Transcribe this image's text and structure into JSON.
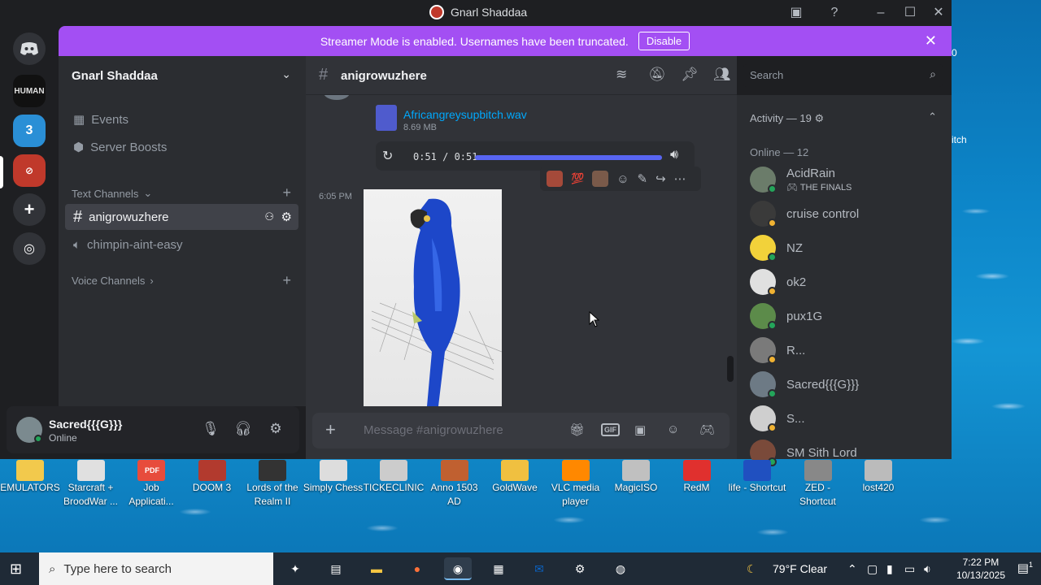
{
  "window": {
    "title": "Gnarl Shaddaa"
  },
  "banner": {
    "text": "Streamer Mode is enabled. Usernames have been truncated.",
    "disable": "Disable"
  },
  "server": {
    "name": "Gnarl Shaddaa"
  },
  "channels": {
    "events": "Events",
    "boosts": "Server Boosts",
    "text_category": "Text Channels",
    "text": [
      "anigrowuzhere",
      "chimpin-aint-easy"
    ],
    "voice_category": "Voice Channels"
  },
  "rail": {
    "server1": "HUMAN",
    "server2": "3"
  },
  "user": {
    "name": "Sacred{{{G}}}",
    "status": "Online"
  },
  "chat": {
    "channel": "anigrowuzhere",
    "file_name": "Africangreysupbitch.wav",
    "file_size": "8.69 MB",
    "audio_time": "0:51 / 0:51",
    "audio_progress": 1.0,
    "react_emoji": "💯",
    "msg_time": "6:05 PM",
    "placeholder": "Message #anigrowuzhere",
    "gif": "GIF"
  },
  "search": {
    "placeholder": "Search"
  },
  "members": {
    "activity": "Activity — 19",
    "online": "Online — 12",
    "list": [
      {
        "name": "AcidRain",
        "activity": "THE FINALS",
        "status": "#23a55a"
      },
      {
        "name": "cruise control",
        "activity": "",
        "status": "#f0b232"
      },
      {
        "name": "NZ",
        "activity": "",
        "status": "#23a55a"
      },
      {
        "name": "ok2",
        "activity": "",
        "status": "#f0b232"
      },
      {
        "name": "pux1G",
        "activity": "",
        "status": "#23a55a"
      },
      {
        "name": "R...",
        "activity": "",
        "status": "#f0b232"
      },
      {
        "name": "Sacred{{{G}}}",
        "activity": "",
        "status": "#23a55a"
      },
      {
        "name": "S...",
        "activity": "",
        "status": "#f0b232"
      },
      {
        "name": "SM Sith Lord",
        "activity": "",
        "status": "#23a55a"
      }
    ]
  },
  "desktop": {
    "icons": [
      "EMULATORS",
      "Starcraft + BroodWar ...",
      "Job Applicati...",
      "DOOM 3",
      "Lords of the Realm II",
      "Simply Chess",
      "TICKECLINIC",
      "Anno 1503 AD",
      "GoldWave",
      "VLC media player",
      "MagicISO",
      "RedM",
      "life - Shortcut",
      "ZED - Shortcut",
      "lost420"
    ],
    "pdf_label": "PDF",
    "right_text": "itch",
    "right_digit": "0"
  },
  "taskbar": {
    "search_placeholder": "Type here to search",
    "weather": "79°F  Clear",
    "time": "7:22 PM",
    "date": "10/13/2025",
    "notif_count": "1"
  },
  "colors": {
    "accent": "#5865f2",
    "banner": "#a34ff3",
    "online": "#23a55a",
    "idle": "#f0b232"
  }
}
